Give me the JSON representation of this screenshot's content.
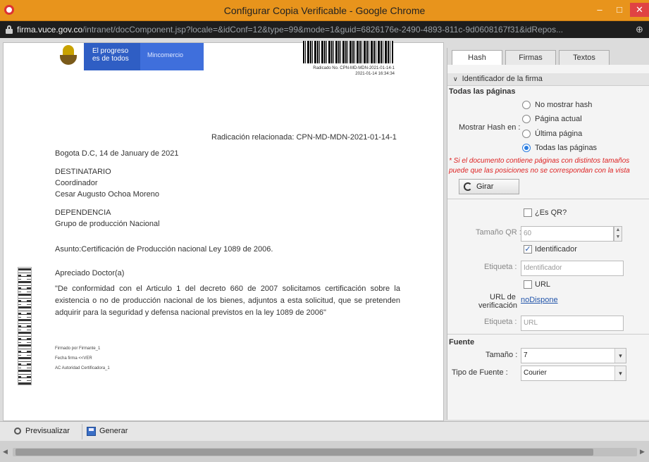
{
  "window": {
    "title": "Configurar Copia Verificable - Google Chrome",
    "min_glyph": "–",
    "max_glyph": "□",
    "close_glyph": "✕"
  },
  "address": {
    "domain": "firma.vuce.gov.co",
    "path": "/intranet/docComponent.jsp?locale=&idConf=12&type=99&mode=1&guid=6826176e-2490-4893-811c-9d0608167f31&idRepos...",
    "zoom_glyph": "⊕"
  },
  "document": {
    "logo_line1": "El progreso",
    "logo_line2": "es de todos",
    "logo_ministry": "Mincomercio",
    "barcode_text_1": "Radicado No. CPN-MD-MDN-2021-01-14-1",
    "barcode_text_2": "2021-01-14 16:34:34",
    "radicacion": "Radicación relacionada: CPN-MD-MDN-2021-01-14-1",
    "date_line": "Bogota D.C, 14 de January de 2021",
    "destinatario_label": "DESTINATARIO",
    "destinatario_role": "Coordinador",
    "destinatario_name": "Cesar Augusto Ochoa Moreno",
    "dependencia_label": "DEPENDENCIA",
    "dependencia_value": "Grupo de producción Nacional",
    "asunto": "Asunto:Certificación de Producción nacional Ley 1089 de 2006.",
    "greeting": "Apreciado Doctor(a)",
    "body": "\"De conformidad con el Articulo 1 del decreto 660 de 2007 solicitamos certificación sobre la existencia o no de producción nacional de los bienes, adjuntos a esta solicitud, que se pretenden adquirir para la seguridad y defensa nacional previstos en la ley 1089 de 2006\"",
    "sig_1": "Firmado por Firmante_1",
    "sig_2": "Fecha firma <<VER",
    "sig_3": "AC Autoridad Certificadora_1"
  },
  "panel": {
    "tabs": [
      "Hash",
      "Firmas",
      "Textos"
    ],
    "active_tab": "Hash",
    "section_title": "Identificador de la firma",
    "section_chevron": "∨",
    "pages_title": "Todas las páginas",
    "mostrar_hash_label": "Mostrar Hash en :",
    "radio_options": [
      {
        "label": "No mostrar hash",
        "selected": false
      },
      {
        "label": "Página actual",
        "selected": false
      },
      {
        "label": "Última página",
        "selected": false
      },
      {
        "label": "Todas las páginas",
        "selected": true
      }
    ],
    "warning_line1": "* Si el documento contiene páginas con distintos tamaños",
    "warning_line2": "puede que las posiciones no se correspondan con la vista",
    "rotate_label": "Girar",
    "qr_label": "¿Es QR?",
    "qr_checked": false,
    "qr_size_label": "Tamaño QR :",
    "qr_size_value": "60",
    "identificador_label": "Identificador",
    "identificador_checked": true,
    "etiqueta_label": "Etiqueta :",
    "etiqueta_value": "Identificador",
    "url_label": "URL",
    "url_checked": false,
    "url_verif_label_1": "URL de",
    "url_verif_label_2": "verificación",
    "url_verif_link": "noDispone",
    "etiqueta2_label": "Etiqueta :",
    "etiqueta2_value": "URL",
    "fuente_title": "Fuente",
    "size_label": "Tamaño :",
    "size_value": "7",
    "font_type_label": "Tipo de Fuente :",
    "font_type_value": "Courier",
    "checkmark_glyph": "✓",
    "spin_up_glyph": "▲",
    "spin_down_glyph": "▼",
    "select_arrow_glyph": "▾"
  },
  "toolbar": {
    "preview_label": "Previsualizar",
    "generate_label": "Generar"
  },
  "scroll": {
    "left_glyph": "◀",
    "right_glyph": "▶"
  }
}
